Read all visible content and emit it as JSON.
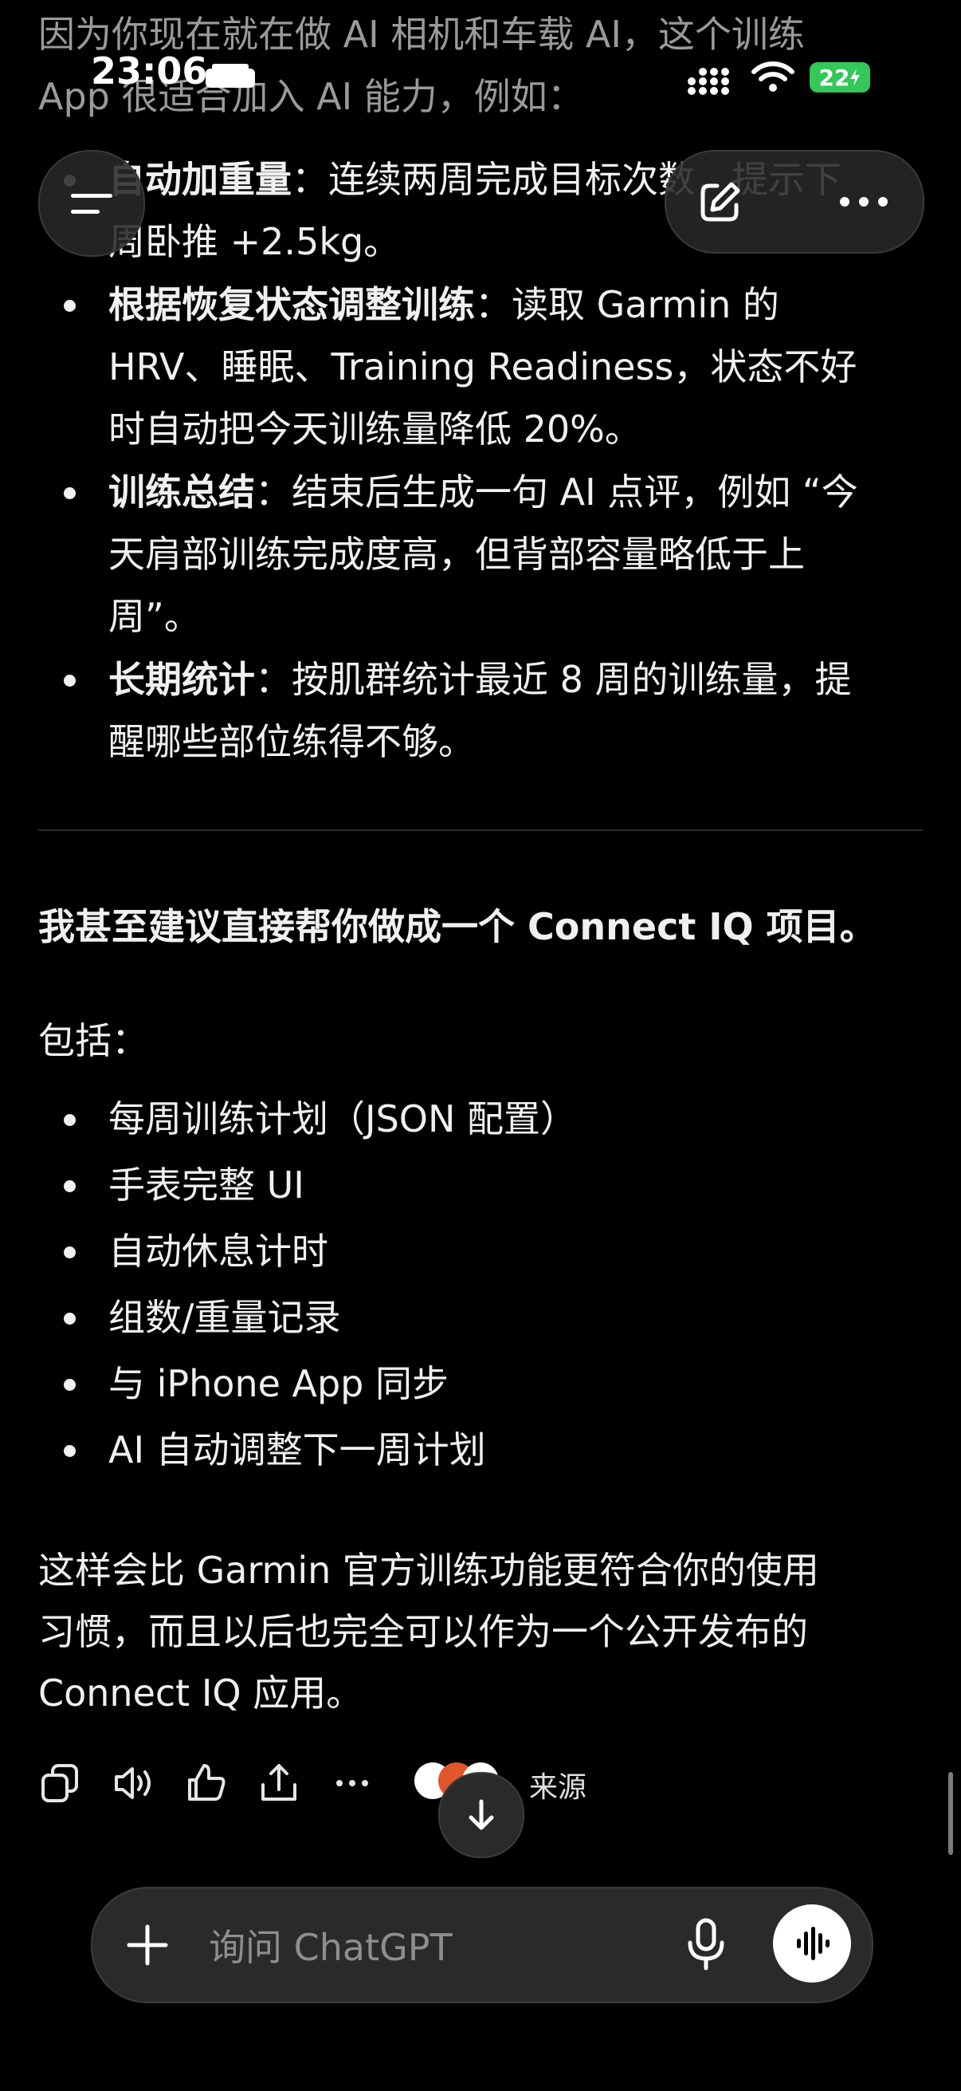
{
  "status_bar": {
    "time": "23:06",
    "battery": "22"
  },
  "message": {
    "intro_line1": "因为你现在就在做 AI 相机和车载 AI，这个训练",
    "intro_line2": "App 很适合加入 AI 能力，例如：",
    "ai_features": [
      {
        "title": "自动加重量",
        "lines": [
          "：连续两周完成目标次数，提示下",
          "周卧推 +2.5kg。"
        ]
      },
      {
        "title": "根据恢复状态调整训练",
        "lines": [
          "：读取 Garmin 的",
          "HRV、睡眠、Training Readiness，状态不好",
          "时自动把今天训练量降低 20%。"
        ]
      },
      {
        "title": "训练总结",
        "lines": [
          "：结束后生成一句 AI 点评，例如 “今",
          "天肩部训练完成度高，但背部容量略低于上",
          "周”。"
        ]
      },
      {
        "title": "长期统计",
        "lines": [
          "：按肌群统计最近 8 周的训练量，提",
          "醒哪些部位练得不够。"
        ]
      }
    ],
    "suggestion": "我甚至建议直接帮你做成一个 Connect IQ 项目。",
    "includes_label": "包括：",
    "includes": [
      "每周训练计划（JSON 配置）",
      "手表完整 UI",
      "自动休息计时",
      "组数/重量记录",
      "与 iPhone App 同步",
      "AI 自动调整下一周计划"
    ],
    "closing": [
      "这样会比 Garmin 官方训练功能更符合你的使用",
      "习惯，而且以后也完全可以作为一个公开发布的",
      "Connect IQ 应用。"
    ]
  },
  "actions": {
    "sources_label": "来源"
  },
  "composer": {
    "placeholder": "询问 ChatGPT"
  }
}
